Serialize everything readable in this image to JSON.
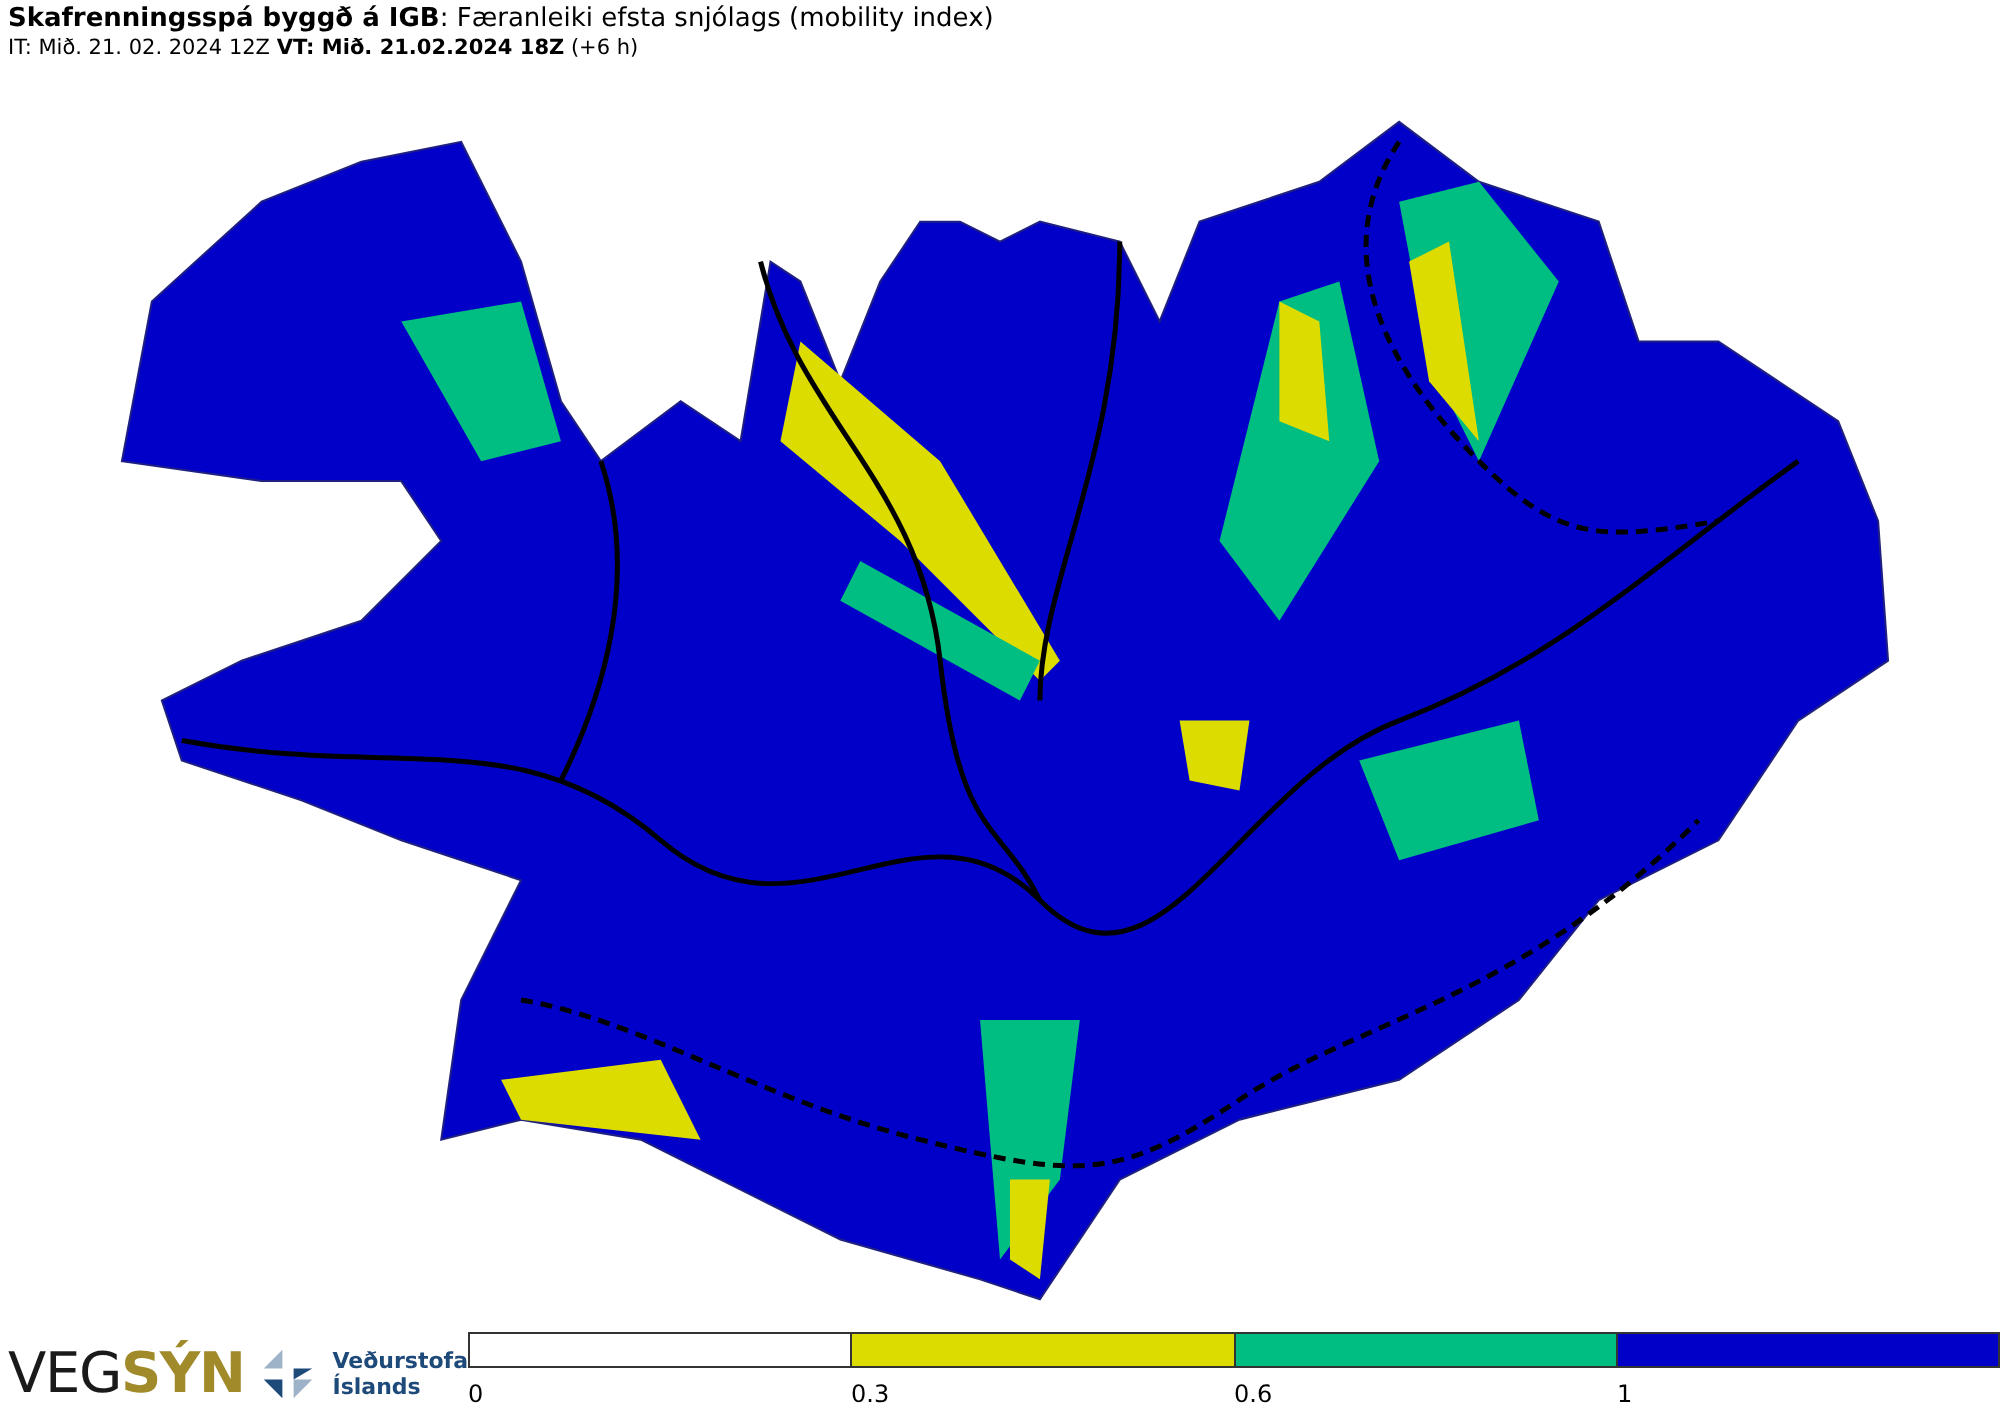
{
  "header": {
    "title": "**Skafrenningsspá byggð á IGB**: Færanleiki efsta snjólags (mobility index)",
    "subtitle": "IT: Mið. 21. 02. 2024 12Z **VT: Mið. 21.02.2024 18Z** (+6 h)"
  },
  "logos": {
    "vegsyn_left": "VEG",
    "vegsyn_right": "SÝN",
    "agency_line_1": "Veðurstofa",
    "agency_line_2": "Íslands"
  },
  "legend": {
    "segments": [
      {
        "color": "#ffffff",
        "label": "0"
      },
      {
        "color": "#dcdc00",
        "label": "0.3"
      },
      {
        "color": "#00be82",
        "label": "0.6"
      },
      {
        "color": "#0000c8",
        "label": "1"
      }
    ]
  }
}
